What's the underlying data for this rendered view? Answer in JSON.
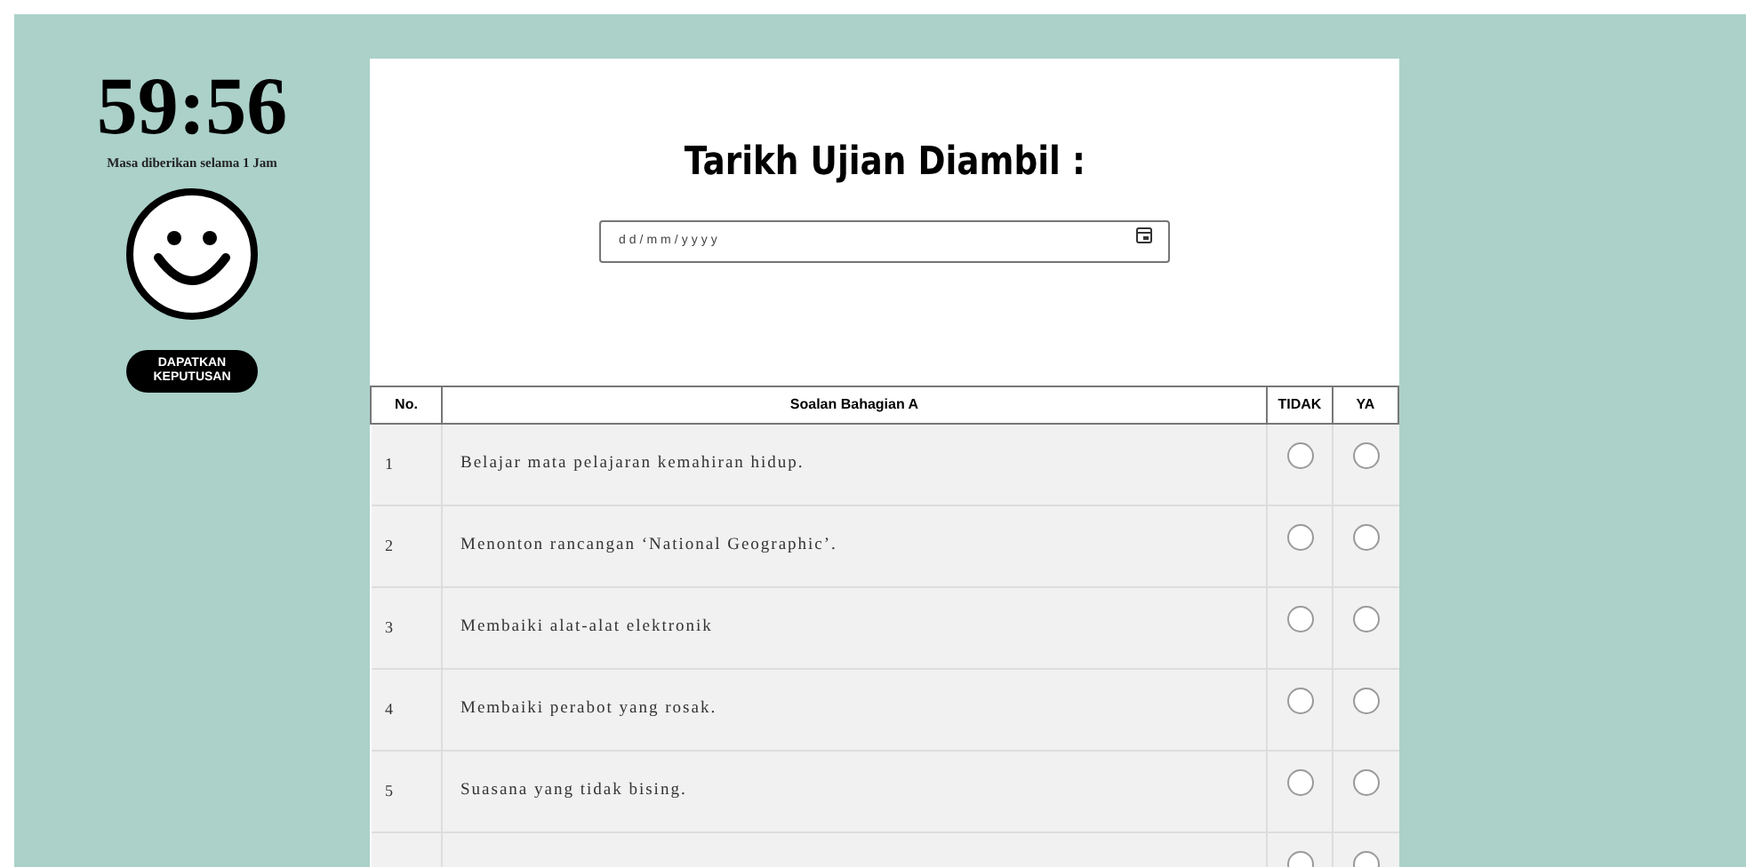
{
  "timer": {
    "time": "59:56",
    "caption": "Masa diberikan selama 1 Jam",
    "button": "DAPATKAN KEPUTUSAN"
  },
  "form": {
    "title": "Tarikh Ujian Diambil :",
    "date_field": {
      "placeholder": "dd/mm/yyyy"
    }
  },
  "table": {
    "columns": [
      "No.",
      "Soalan Bahagian A",
      "TIDAK",
      "YA"
    ],
    "rows": [
      {
        "no": "1",
        "question": "Belajar mata pelajaran kemahiran hidup.",
        "tidak": false,
        "ya": false
      },
      {
        "no": "2",
        "question": "Menonton rancangan ‘National Geographic’.",
        "tidak": false,
        "ya": false
      },
      {
        "no": "3",
        "question": "Membaiki alat-alat elektronik",
        "tidak": false,
        "ya": false
      },
      {
        "no": "4",
        "question": "Membaiki perabot yang rosak.",
        "tidak": false,
        "ya": false
      },
      {
        "no": "5",
        "question": "Suasana yang tidak bising.",
        "tidak": false,
        "ya": false
      },
      {
        "tidak": false,
        "ya": false
      }
    ]
  }
}
